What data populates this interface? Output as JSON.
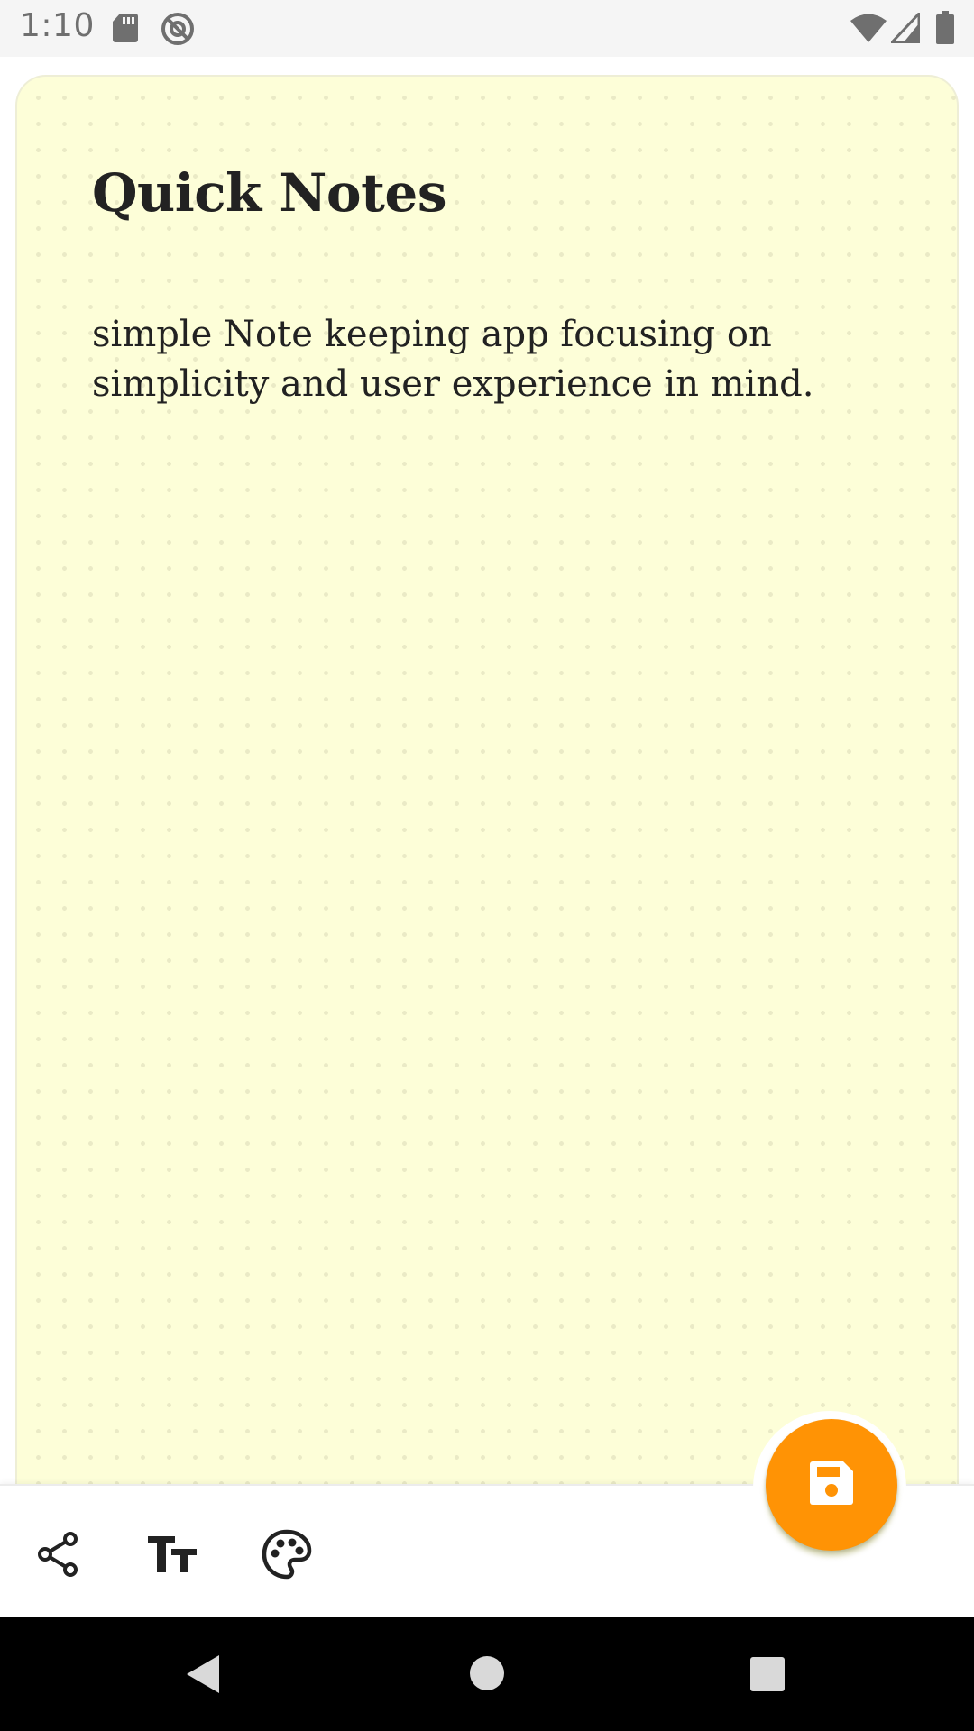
{
  "status_bar": {
    "time": "1:10",
    "left_icons": [
      "sd-card-icon",
      "at-sign-icon"
    ],
    "right_icons": [
      "wifi-icon",
      "cellular-signal-icon",
      "battery-icon"
    ]
  },
  "note": {
    "title": "Quick Notes",
    "body": "simple Note keeping app focusing on simplicity and user experience in mind.",
    "background_color": "#fdfed8"
  },
  "toolbar": {
    "tools": [
      "share-icon",
      "text-size-icon",
      "palette-icon"
    ],
    "fab_icon": "save-icon",
    "fab_color": "#ff9305"
  },
  "nav_bar": {
    "buttons": [
      "back-icon",
      "home-icon",
      "recents-icon"
    ]
  }
}
